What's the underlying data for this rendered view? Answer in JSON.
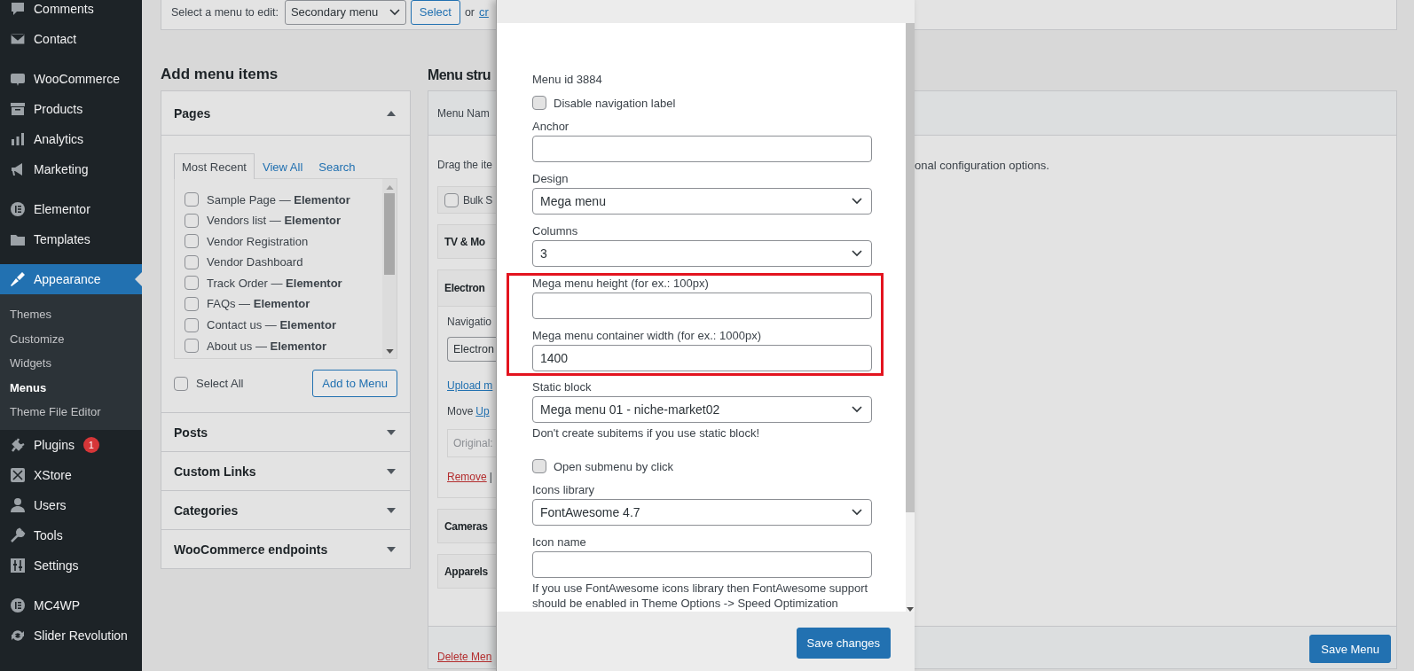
{
  "sidebar": {
    "groups": [
      [
        {
          "label": "Comments",
          "selected": false
        },
        {
          "label": "Contact",
          "selected": false
        }
      ],
      [
        {
          "label": "WooCommerce",
          "selected": false
        },
        {
          "label": "Products",
          "selected": false
        },
        {
          "label": "Analytics",
          "selected": false
        },
        {
          "label": "Marketing",
          "selected": false
        }
      ],
      [
        {
          "label": "Elementor",
          "selected": false
        },
        {
          "label": "Templates",
          "selected": false
        }
      ],
      [
        {
          "label": "Appearance",
          "selected": true,
          "children": [
            {
              "label": "Themes",
              "selected": false
            },
            {
              "label": "Customize",
              "selected": false
            },
            {
              "label": "Widgets",
              "selected": false
            },
            {
              "label": "Menus",
              "selected": true
            },
            {
              "label": "Theme File Editor",
              "selected": false
            }
          ]
        },
        {
          "label": "Plugins",
          "selected": false,
          "badge": "1"
        },
        {
          "label": "XStore",
          "selected": false
        },
        {
          "label": "Users",
          "selected": false
        },
        {
          "label": "Tools",
          "selected": false
        },
        {
          "label": "Settings",
          "selected": false
        }
      ],
      [
        {
          "label": "MC4WP",
          "selected": false
        },
        {
          "label": "Slider Revolution",
          "selected": false
        }
      ]
    ]
  },
  "menu_select": {
    "label": "Select a menu to edit:",
    "value": "Secondary menu",
    "button": "Select",
    "prefix": "or",
    "link": "cr"
  },
  "add_menu_items": {
    "heading": "Add menu items",
    "sections": [
      {
        "title": "Pages",
        "expanded": true,
        "tabs": [
          {
            "label": "Most Recent",
            "selected": true
          },
          {
            "label": "View All",
            "selected": false
          },
          {
            "label": "Search",
            "selected": false
          }
        ],
        "pages": [
          {
            "label": "Sample Page — **Elementor**",
            "checked": false
          },
          {
            "label": "Vendors list — **Elementor**",
            "checked": false
          },
          {
            "label": "Vendor Registration",
            "checked": false
          },
          {
            "label": "Vendor Dashboard",
            "checked": false
          },
          {
            "label": "Track Order — **Elementor**",
            "checked": false
          },
          {
            "label": "FAQs — **Elementor**",
            "checked": false
          },
          {
            "label": "Contact us — **Elementor**",
            "checked": false
          },
          {
            "label": "About us — **Elementor**",
            "checked": false
          }
        ],
        "select_all": {
          "label": "Select All",
          "checked": false
        },
        "add_button": "Add to Menu"
      },
      {
        "title": "Posts",
        "expanded": false
      },
      {
        "title": "Custom Links",
        "expanded": false
      },
      {
        "title": "Categories",
        "expanded": false
      },
      {
        "title": "WooCommerce endpoints",
        "expanded": false
      }
    ]
  },
  "menu_structure": {
    "heading": "Menu stru",
    "name_label": "Menu Nam",
    "instructions_start": "Drag the ite",
    "instructions_end": "onal configuration options.",
    "bulk_select": {
      "label": "Bulk S",
      "checked": false
    },
    "items": [
      {
        "title": "TV & Mo",
        "expanded": false
      },
      {
        "title": "Electron",
        "expanded": true,
        "navigation_label": "Navigatio",
        "navigation_value": "Electron",
        "upload_link": "Upload m",
        "move_label": "Move",
        "move_link": "Up",
        "original_label": "Original:",
        "remove_link": "Remove",
        "separator": "|"
      },
      {
        "title": "Cameras",
        "expanded": false
      },
      {
        "title": "Apparels",
        "expanded": false
      }
    ],
    "delete_link": "Delete Men",
    "save_button": "Save Menu"
  },
  "modal": {
    "menu_id": "Menu id 3884",
    "fields": [
      {
        "kind": "checkbox",
        "label": "Disable navigation label",
        "checked": false
      },
      {
        "kind": "text",
        "label": "Anchor"
      },
      {
        "kind": "select",
        "label": "Design",
        "value": "Mega menu"
      },
      {
        "kind": "select",
        "label": "Columns",
        "value": "3"
      },
      {
        "kind": "frame",
        "fields": [
          {
            "kind": "text",
            "label": "Mega menu height (for ex.: 100px)"
          },
          {
            "kind": "text",
            "label": "Mega menu container width (for ex.: 1000px)",
            "value": "1400"
          }
        ]
      },
      {
        "kind": "select",
        "label": "Static block",
        "value": "Mega menu 01 - niche-market02",
        "help": "Don't create subitems if you use static block!"
      },
      {
        "kind": "checkbox",
        "label": "Open submenu by click",
        "checked": false
      },
      {
        "kind": "select",
        "label": "Icons library",
        "value": "FontAwesome 4.7"
      },
      {
        "kind": "text",
        "label": "Icon name",
        "help": "If you use FontAwesome icons library then FontAwesome support should be enabled in Theme Options -> Speed Optimization"
      }
    ],
    "save_button": "Save changes"
  }
}
